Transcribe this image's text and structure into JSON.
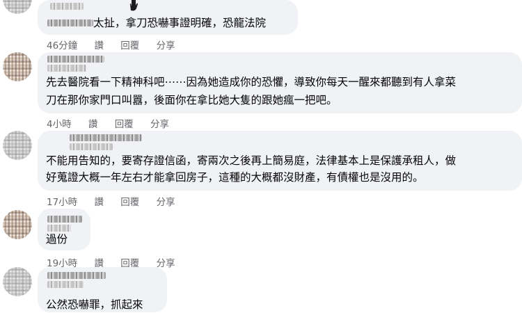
{
  "comments": [
    {
      "text": "太扯，拿刀恐嚇事證明確，恐龍法院",
      "time": "46分鐘",
      "like": "讚",
      "reply": "回覆",
      "share": "分享"
    },
    {
      "text_lines": [
        "先去醫院看一下精神科吧⋯⋯因為她造成你的恐懼，導致你每天一醒來都聽到有人拿菜",
        "刀在那你家門口叫囂，後面你在拿比她大隻的跟她瘋一把吧。"
      ],
      "time": "4小時",
      "like": "讚",
      "reply": "回覆",
      "share": "分享"
    },
    {
      "text_lines": [
        "不能用告知的，要寄存證信函，寄兩次之後再上簡易庭，法律基本上是保護承租人，做",
        "好蒐證大概一年左右才能拿回房子，這種的大概都沒財產，有債權也是沒用的。"
      ],
      "time": "17小時",
      "like": "讚",
      "reply": "回覆",
      "share": "分享"
    },
    {
      "text": "過份",
      "time": "19小時",
      "like": "讚",
      "reply": "回覆",
      "share": "分享"
    },
    {
      "text": "公然恐嚇罪，抓起來"
    }
  ],
  "icons": {
    "hand": "raised-hand-icon"
  },
  "colors": {
    "bubble": "#f0f2f5",
    "meta_text": "#65676b",
    "text": "#050505"
  }
}
